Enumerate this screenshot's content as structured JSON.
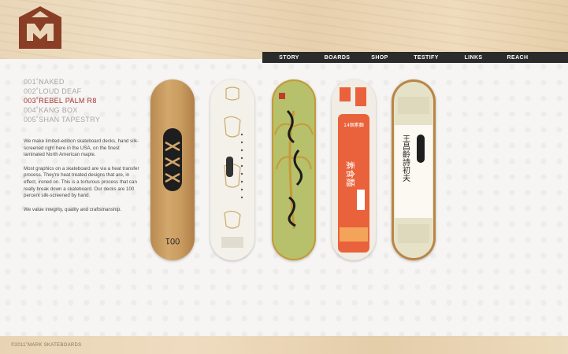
{
  "nav": {
    "items": [
      "STORY",
      "BOARDS",
      "SHOP",
      "TESTIFY",
      "LINKS",
      "REACH"
    ]
  },
  "boards": {
    "list": [
      "001˚NAKED",
      "002˚LOUD DEAF",
      "003˚REBEL PALM R8",
      "004˚KANG BOX",
      "005˚SHAN TAPESTRY"
    ],
    "active_index": 2
  },
  "description": {
    "p1": "We make limited-edition skateboard decks, hand silk-screened right here in the USA, on the finest laminated North American maple.",
    "p2": "Most graphics on a skateboard are via a heat transfer process. They're heat treated designs that are, in effect, ironed on. This is a torturous process that can really break down a skateboard. Our decks are 100 percent silk-screened by hand.",
    "p3": "We value integrity, quality and craftsmanship."
  },
  "decks": {
    "deck1_number": "001",
    "deck4_top_text": "14個素麵",
    "deck4_main_text": "素食麵",
    "deck5_text": "王昌齡詩初夫"
  },
  "footer": {
    "copyright": "©2011˚MARK SKATEBOARDS"
  },
  "colors": {
    "nav_bg": "#2b2b2b",
    "active_item": "#a5342e",
    "logo": "#8a3e26"
  },
  "icons": {
    "logo": "mark-logo-icon"
  }
}
